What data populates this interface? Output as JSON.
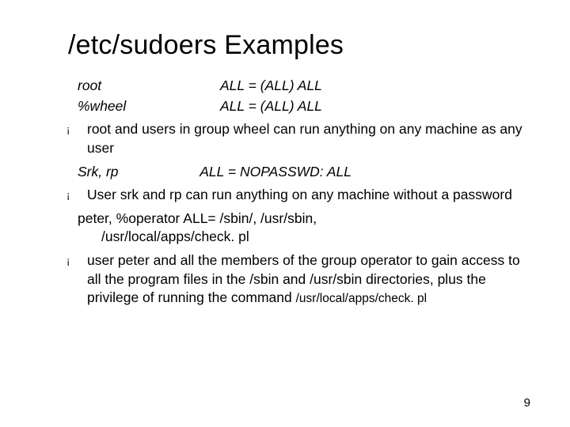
{
  "title": "/etc/sudoers Examples",
  "rules": {
    "r1": {
      "who": "root",
      "spec": "ALL = (ALL) ALL"
    },
    "r2": {
      "who": "%wheel",
      "spec": "ALL = (ALL) ALL"
    },
    "r3": {
      "who": "Srk, rp",
      "spec": "ALL = NOPASSWD: ALL"
    },
    "r4_line1": "peter, %operator ALL= /sbin/, /usr/sbin,",
    "r4_line2": "/usr/local/apps/check. pl"
  },
  "bullets": {
    "b1": "root and users in group wheel can run anything on any machine as any user",
    "b2": "User srk and rp can run anything on any machine without a password",
    "b3_part1": " user peter and all the members of the group operator to gain access to all the program files in the /sbin and /usr/sbin directories, plus the privilege of running the command ",
    "b3_path": "/usr/local/apps/check. pl"
  },
  "marker": "¡",
  "page_number": "9"
}
